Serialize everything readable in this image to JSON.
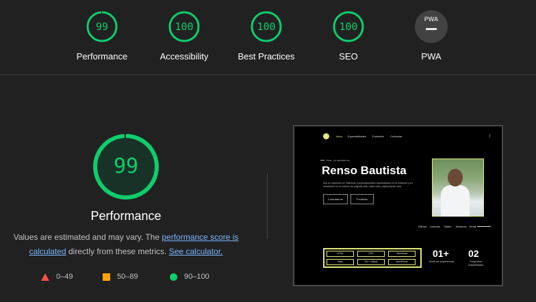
{
  "gauges": [
    {
      "score": "99",
      "label": "Performance",
      "value": 0.99,
      "color": "#0cce6b"
    },
    {
      "score": "100",
      "label": "Accessibility",
      "value": 1.0,
      "color": "#0cce6b"
    },
    {
      "score": "100",
      "label": "Best Practices",
      "value": 1.0,
      "color": "#0cce6b"
    },
    {
      "score": "100",
      "label": "SEO",
      "value": 1.0,
      "color": "#0cce6b"
    }
  ],
  "pwa": {
    "badge": "PWA",
    "label": "PWA"
  },
  "main": {
    "score": "99",
    "value": 0.99,
    "title": "Performance",
    "desc_prefix": "Values are estimated and may vary. The ",
    "link_score": "performance score is calculated",
    "desc_mid": " directly from these metrics. ",
    "link_calc": "See calculator."
  },
  "legend": {
    "fail": "0–49",
    "average": "50–89",
    "pass": "90–100"
  },
  "colors": {
    "pass": "#0cce6b",
    "average": "#ffa400",
    "fail": "#ff4e42",
    "accent": "#e4e97a"
  },
  "screenshot": {
    "nav": [
      "Inicio",
      "Especialidades",
      "Portafolio",
      "Contactar"
    ],
    "greeting": "Hola, mi nombre es",
    "name": "Renso Bautista",
    "bio": "Soy un Ingeniero en Sistemas Computacionales especializado en la creación y en soluciones en el entorno de páginas web, sitios web y aplicaciones web.",
    "buttons": [
      "Contratarme",
      "Portafolio"
    ],
    "social": [
      "GitHub",
      "LinkedIn",
      "Twitter",
      "Behance",
      "Gmail"
    ],
    "tech": [
      "HTML",
      "CSS",
      "JavaScript",
      "Sass",
      "Git + Github",
      "WordPress"
    ],
    "stats": [
      {
        "num": "01+",
        "label": "Años de experiencia"
      },
      {
        "num": "02",
        "label": "Proyectos completados"
      }
    ]
  }
}
